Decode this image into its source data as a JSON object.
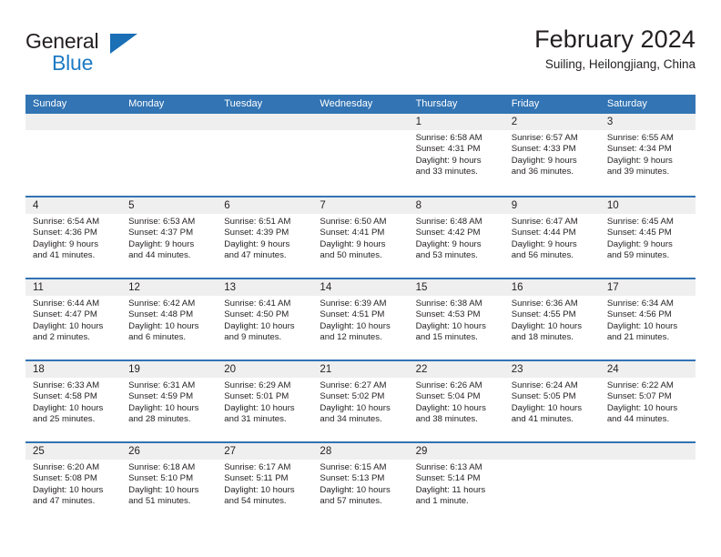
{
  "brand": {
    "name_top": "General",
    "name_bottom": "Blue",
    "flag_icon": "blue-triangle-flag-icon",
    "color_text": "#231f20",
    "color_blue": "#1e7bc4"
  },
  "header": {
    "title": "February 2024",
    "subtitle": "Suiling, Heilongjiang, China"
  },
  "theme": {
    "header_blue": "#3274b4",
    "date_band_gray": "#efefef",
    "text": "#231f20",
    "cell_bg": "#ffffff"
  },
  "weekdays": [
    "Sunday",
    "Monday",
    "Tuesday",
    "Wednesday",
    "Thursday",
    "Friday",
    "Saturday"
  ],
  "weeks": [
    [
      {
        "day": "",
        "lines": []
      },
      {
        "day": "",
        "lines": []
      },
      {
        "day": "",
        "lines": []
      },
      {
        "day": "",
        "lines": []
      },
      {
        "day": "1",
        "lines": [
          "Sunrise: 6:58 AM",
          "Sunset: 4:31 PM",
          "Daylight: 9 hours",
          "and 33 minutes."
        ]
      },
      {
        "day": "2",
        "lines": [
          "Sunrise: 6:57 AM",
          "Sunset: 4:33 PM",
          "Daylight: 9 hours",
          "and 36 minutes."
        ]
      },
      {
        "day": "3",
        "lines": [
          "Sunrise: 6:55 AM",
          "Sunset: 4:34 PM",
          "Daylight: 9 hours",
          "and 39 minutes."
        ]
      }
    ],
    [
      {
        "day": "4",
        "lines": [
          "Sunrise: 6:54 AM",
          "Sunset: 4:36 PM",
          "Daylight: 9 hours",
          "and 41 minutes."
        ]
      },
      {
        "day": "5",
        "lines": [
          "Sunrise: 6:53 AM",
          "Sunset: 4:37 PM",
          "Daylight: 9 hours",
          "and 44 minutes."
        ]
      },
      {
        "day": "6",
        "lines": [
          "Sunrise: 6:51 AM",
          "Sunset: 4:39 PM",
          "Daylight: 9 hours",
          "and 47 minutes."
        ]
      },
      {
        "day": "7",
        "lines": [
          "Sunrise: 6:50 AM",
          "Sunset: 4:41 PM",
          "Daylight: 9 hours",
          "and 50 minutes."
        ]
      },
      {
        "day": "8",
        "lines": [
          "Sunrise: 6:48 AM",
          "Sunset: 4:42 PM",
          "Daylight: 9 hours",
          "and 53 minutes."
        ]
      },
      {
        "day": "9",
        "lines": [
          "Sunrise: 6:47 AM",
          "Sunset: 4:44 PM",
          "Daylight: 9 hours",
          "and 56 minutes."
        ]
      },
      {
        "day": "10",
        "lines": [
          "Sunrise: 6:45 AM",
          "Sunset: 4:45 PM",
          "Daylight: 9 hours",
          "and 59 minutes."
        ]
      }
    ],
    [
      {
        "day": "11",
        "lines": [
          "Sunrise: 6:44 AM",
          "Sunset: 4:47 PM",
          "Daylight: 10 hours",
          "and 2 minutes."
        ]
      },
      {
        "day": "12",
        "lines": [
          "Sunrise: 6:42 AM",
          "Sunset: 4:48 PM",
          "Daylight: 10 hours",
          "and 6 minutes."
        ]
      },
      {
        "day": "13",
        "lines": [
          "Sunrise: 6:41 AM",
          "Sunset: 4:50 PM",
          "Daylight: 10 hours",
          "and 9 minutes."
        ]
      },
      {
        "day": "14",
        "lines": [
          "Sunrise: 6:39 AM",
          "Sunset: 4:51 PM",
          "Daylight: 10 hours",
          "and 12 minutes."
        ]
      },
      {
        "day": "15",
        "lines": [
          "Sunrise: 6:38 AM",
          "Sunset: 4:53 PM",
          "Daylight: 10 hours",
          "and 15 minutes."
        ]
      },
      {
        "day": "16",
        "lines": [
          "Sunrise: 6:36 AM",
          "Sunset: 4:55 PM",
          "Daylight: 10 hours",
          "and 18 minutes."
        ]
      },
      {
        "day": "17",
        "lines": [
          "Sunrise: 6:34 AM",
          "Sunset: 4:56 PM",
          "Daylight: 10 hours",
          "and 21 minutes."
        ]
      }
    ],
    [
      {
        "day": "18",
        "lines": [
          "Sunrise: 6:33 AM",
          "Sunset: 4:58 PM",
          "Daylight: 10 hours",
          "and 25 minutes."
        ]
      },
      {
        "day": "19",
        "lines": [
          "Sunrise: 6:31 AM",
          "Sunset: 4:59 PM",
          "Daylight: 10 hours",
          "and 28 minutes."
        ]
      },
      {
        "day": "20",
        "lines": [
          "Sunrise: 6:29 AM",
          "Sunset: 5:01 PM",
          "Daylight: 10 hours",
          "and 31 minutes."
        ]
      },
      {
        "day": "21",
        "lines": [
          "Sunrise: 6:27 AM",
          "Sunset: 5:02 PM",
          "Daylight: 10 hours",
          "and 34 minutes."
        ]
      },
      {
        "day": "22",
        "lines": [
          "Sunrise: 6:26 AM",
          "Sunset: 5:04 PM",
          "Daylight: 10 hours",
          "and 38 minutes."
        ]
      },
      {
        "day": "23",
        "lines": [
          "Sunrise: 6:24 AM",
          "Sunset: 5:05 PM",
          "Daylight: 10 hours",
          "and 41 minutes."
        ]
      },
      {
        "day": "24",
        "lines": [
          "Sunrise: 6:22 AM",
          "Sunset: 5:07 PM",
          "Daylight: 10 hours",
          "and 44 minutes."
        ]
      }
    ],
    [
      {
        "day": "25",
        "lines": [
          "Sunrise: 6:20 AM",
          "Sunset: 5:08 PM",
          "Daylight: 10 hours",
          "and 47 minutes."
        ]
      },
      {
        "day": "26",
        "lines": [
          "Sunrise: 6:18 AM",
          "Sunset: 5:10 PM",
          "Daylight: 10 hours",
          "and 51 minutes."
        ]
      },
      {
        "day": "27",
        "lines": [
          "Sunrise: 6:17 AM",
          "Sunset: 5:11 PM",
          "Daylight: 10 hours",
          "and 54 minutes."
        ]
      },
      {
        "day": "28",
        "lines": [
          "Sunrise: 6:15 AM",
          "Sunset: 5:13 PM",
          "Daylight: 10 hours",
          "and 57 minutes."
        ]
      },
      {
        "day": "29",
        "lines": [
          "Sunrise: 6:13 AM",
          "Sunset: 5:14 PM",
          "Daylight: 11 hours",
          "and 1 minute."
        ]
      },
      {
        "day": "",
        "lines": []
      },
      {
        "day": "",
        "lines": []
      }
    ]
  ]
}
